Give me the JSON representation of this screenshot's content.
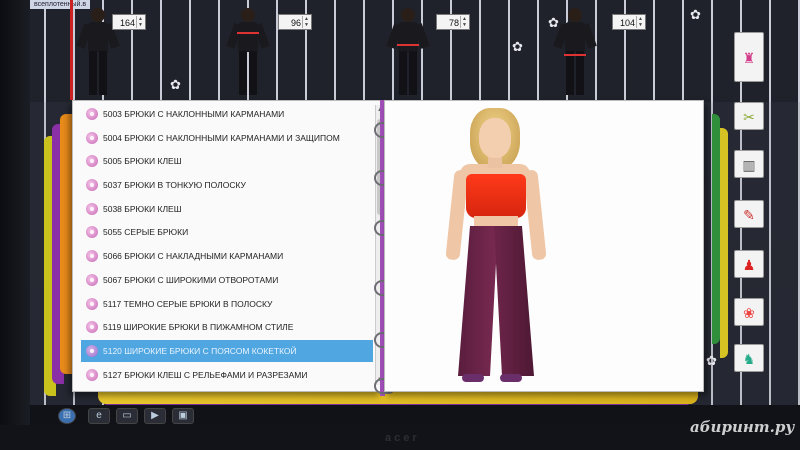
{
  "window": {
    "title": "всеплотенный.в"
  },
  "measurements": [
    {
      "value": "164"
    },
    {
      "value": "96"
    },
    {
      "value": "78"
    },
    {
      "value": "104"
    }
  ],
  "catalog": {
    "items": [
      {
        "label": "5003 БРЮКИ С НАКЛОННЫМИ КАРМАНАМИ"
      },
      {
        "label": "5004 БРЮКИ С НАКЛОННЫМИ КАРМАНАМИ И ЗАЩИПОМ"
      },
      {
        "label": "5005 БРЮКИ КЛЕШ"
      },
      {
        "label": "5037 БРЮКИ В ТОНКУЮ ПОЛОСКУ"
      },
      {
        "label": "5038 БРЮКИ КЛЕШ"
      },
      {
        "label": "5055 СЕРЫЕ БРЮКИ"
      },
      {
        "label": "5066 БРЮКИ С НАКЛАДНЫМИ КАРМАНАМИ"
      },
      {
        "label": "5067 БРЮКИ С ШИРОКИМИ ОТВОРОТАМИ"
      },
      {
        "label": "5117 ТЕМНО СЕРЫЕ БРЮКИ В ПОЛОСКУ"
      },
      {
        "label": "5119 ШИРОКИЕ БРЮКИ В ПИЖАМНОМ СТИЛЕ"
      },
      {
        "label": "5120 ШИРОКИЕ БРЮКИ С ПОЯСОМ КОКЕТКОЙ"
      },
      {
        "label": "5127 БРЮКИ КЛЕШ С РЕЛЬЕФАМИ И РАЗРЕЗАМИ"
      }
    ],
    "selected_index": 10
  },
  "sidebar_tools": [
    {
      "icon": "dress-form-icon"
    },
    {
      "icon": "scissors-icon"
    },
    {
      "icon": "pattern-book-icon"
    },
    {
      "icon": "pencil-icon"
    },
    {
      "icon": "paint-bucket-icon"
    },
    {
      "icon": "color-palette-icon"
    },
    {
      "icon": "sewing-machine-icon"
    }
  ],
  "colors": {
    "selection": "#4fa6e0",
    "bullet": "#c765b2",
    "spine": "#a04fb8",
    "top": "#e8321a",
    "pants": "#6a2248"
  },
  "watermark": {
    "text": "абиринт.ру"
  },
  "monitor": {
    "brand": "acer"
  }
}
